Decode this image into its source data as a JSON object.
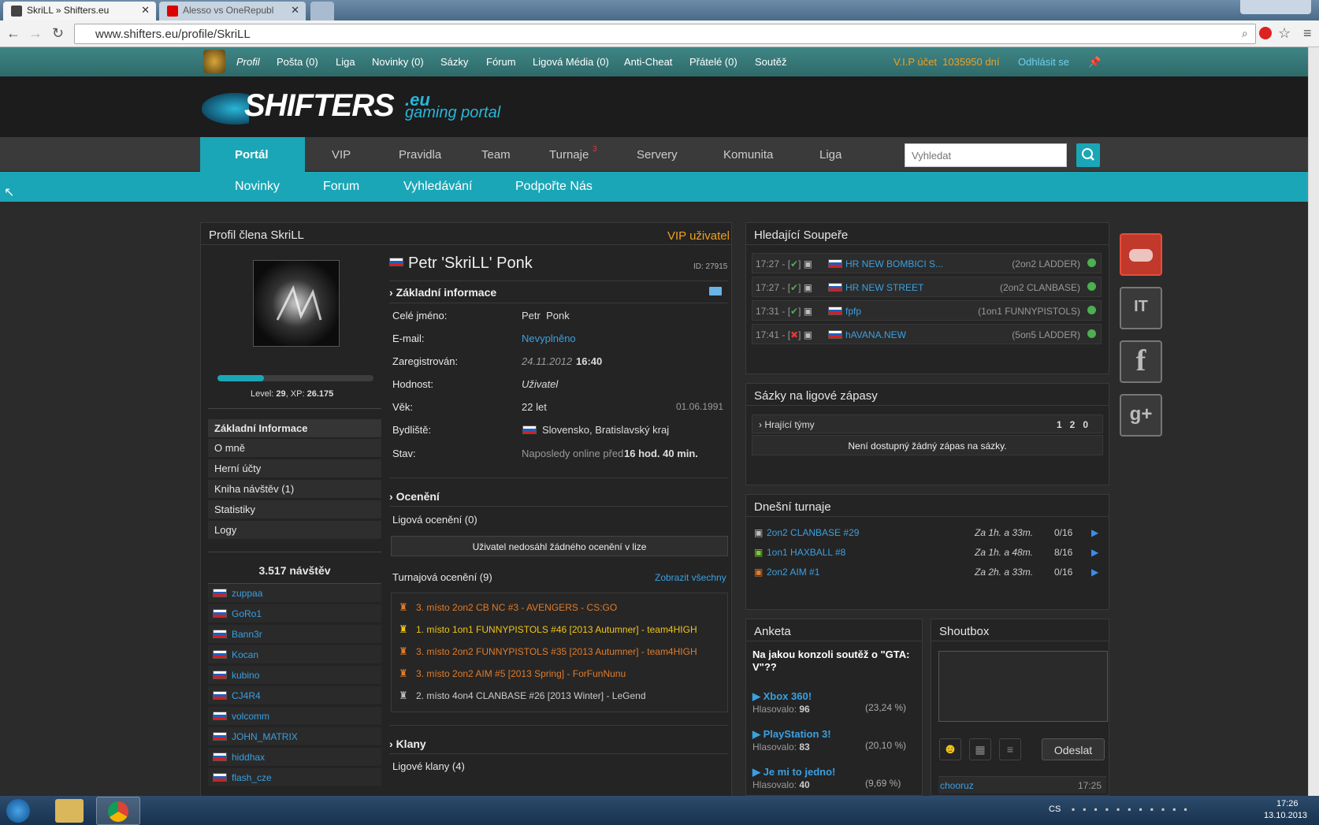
{
  "browser": {
    "tabs": [
      {
        "label": "SkriLL » Shifters.eu"
      },
      {
        "label": "Alesso vs OneRepubl"
      }
    ],
    "url": "www.shifters.eu/profile/SkriLL"
  },
  "topbar": {
    "items": [
      "Profil",
      "Pošta (0)",
      "Liga",
      "Novinky (0)",
      "Sázky",
      "Fórum",
      "Ligová Média (0)",
      "Anti-Cheat",
      "Přátelé (0)",
      "Soutěž"
    ],
    "vip": "V.I.P účet  1035950 dní",
    "logout": "Odhlásit se"
  },
  "logo": {
    "main": "SHIFTERS",
    "eu": ".eu",
    "sub": "gaming portal"
  },
  "mainnav": {
    "items": [
      "Portál",
      "VIP",
      "Pravidla",
      "Team",
      "Turnaje",
      "Servery",
      "Komunita",
      "Liga"
    ],
    "turnaje_badge": "3",
    "search_placeholder": "Vyhledat"
  },
  "subnav": [
    "Novinky",
    "Forum",
    "Vyhledávání",
    "Podpořte Nás"
  ],
  "profile": {
    "header": "Profil člena SkriLL",
    "vip_label": "VIP uživatel",
    "level_label": "Level:",
    "level": "29",
    "xp_label": "XP:",
    "xp": "26.175",
    "xp_fraction": 0.3,
    "name": "Petr 'SkriLL' Ponk",
    "id": "ID: 27915",
    "section_basic": "Základní informace",
    "fields": [
      {
        "label": "Celé jméno:",
        "value": "Petr  Ponk"
      },
      {
        "label": "E-mail:",
        "value": "Nevyplněno"
      },
      {
        "label": "Zaregistrován:",
        "value": "24.11.2012",
        "extra": "16:40"
      },
      {
        "label": "Hodnost:",
        "value": "Uživatel"
      },
      {
        "label": "Věk:",
        "value": "22 let",
        "extra": "01.06.1991"
      },
      {
        "label": "Bydliště:",
        "value": "Slovensko, Bratislavský kraj"
      },
      {
        "label": "Stav:",
        "value": "Naposledy online před",
        "extra": "16 hod. 40 min."
      }
    ],
    "section_awards": "Ocenění",
    "league_awards": "Ligová ocenění (0)",
    "no_league_awards": "Uživatel nedosáhl žádného ocenění v lize",
    "tournament_awards": "Turnajová ocenění (9)",
    "show_all": "Zobrazit všechny",
    "awards": [
      "3. místo 2on2 CB NC #3 - AVENGERS - CS:GO",
      "1. místo 1on1 FUNNYPISTOLS #46 [2013 Autumner] - team4HIGH",
      "3. místo 2on2 FUNNYPISTOLS #35 [2013 Autumner] - team4HIGH",
      "3. místo 2on2 AIM #5 [2013 Spring] - ForFunNunu",
      "2. místo 4on4 CLANBASE #26 [2013 Winter] - LeGend"
    ],
    "section_clans": "Klany",
    "league_clans": "Ligové klany (4)"
  },
  "sidemenu": [
    "Základní Informace",
    "O mně",
    "Herní účty",
    "Kniha návštěv (1)",
    "Statistiky",
    "Logy"
  ],
  "visits": {
    "title": "3.517 návštěv",
    "users": [
      "zuppaa",
      "GoRo1",
      "Bann3r",
      "Kocan",
      "kubino",
      "CJ4R4",
      "volcomm",
      "JOHN_MATRIX",
      "hiddhax",
      "flash_cze"
    ]
  },
  "opponents": {
    "title": "Hledající Soupeře",
    "rows": [
      {
        "time": "17:27",
        "name": "HR NEW BOMBICI S...",
        "type": "(2on2 LADDER)"
      },
      {
        "time": "17:27",
        "name": "HR NEW STREET",
        "type": "(2on2 CLANBASE)"
      },
      {
        "time": "17:31",
        "name": "fpfp",
        "type": "(1on1 FUNNYPISTOLS)"
      },
      {
        "time": "17:41",
        "name": "hAVANA.NEW",
        "type": "(5on5 LADDER)"
      }
    ]
  },
  "bets": {
    "title": "Sázky na ligové zápasy",
    "teams": "Hrající týmy",
    "nums": [
      "1",
      "2",
      "0"
    ],
    "empty": "Není dostupný žádný zápas na sázky."
  },
  "tournaments": {
    "title": "Dnešní turnaje",
    "rows": [
      {
        "name": "2on2 CLANBASE #29",
        "when": "Za 1h. a 33m.",
        "slots": "0/16"
      },
      {
        "name": "1on1 HAXBALL #8",
        "when": "Za 1h. a 48m.",
        "slots": "8/16"
      },
      {
        "name": "2on2 AIM #1",
        "when": "Za 2h. a 33m.",
        "slots": "0/16"
      }
    ]
  },
  "poll": {
    "title": "Anketa",
    "question": "Na jakou konzoli soutěž o \"GTA: V\"??",
    "voted_label": "Hlasovalo:",
    "options": [
      {
        "label": "Xbox 360!",
        "votes": "96",
        "pct": "(23,24 %)"
      },
      {
        "label": "PlayStation 3!",
        "votes": "83",
        "pct": "(20,10 %)"
      },
      {
        "label": "Je mi to jedno!",
        "votes": "40",
        "pct": "(9,69 %)"
      }
    ]
  },
  "shoutbox": {
    "title": "Shoutbox",
    "send": "Odeslat",
    "last_user": "chooruz",
    "last_time": "17:25"
  },
  "taskbar": {
    "lang": "CS",
    "time": "17:26",
    "date": "13.10.2013"
  },
  "colors": {
    "accent": "#1aa6b7",
    "link": "#3aa0e0",
    "orange": "#e07b2a",
    "gold": "#f0c419"
  }
}
